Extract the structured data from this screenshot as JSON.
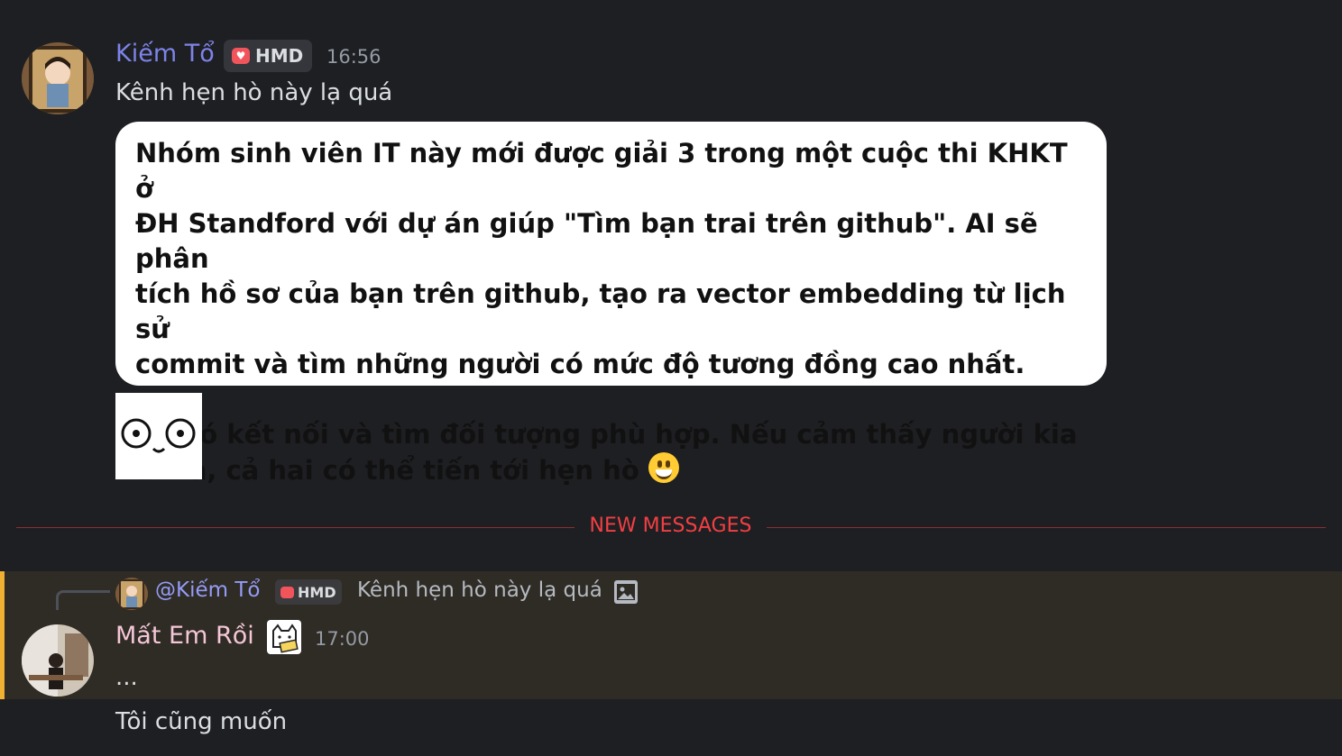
{
  "messages": [
    {
      "author": "Kiếm Tổ",
      "author_color": "#7d84e8",
      "badge": "HMD",
      "time": "16:56",
      "text": "Kênh hẹn hò này lạ quá",
      "card_paragraphs": [
        "Nhóm sinh viên IT này mới được giải 3 trong một cuộc thi KHKT ở\nĐH Standford với dự án giúp \"Tìm bạn trai trên github\". AI sẽ phân\ntích hồ sơ của bạn trên github, tạo ra vector embedding từ lịch sử\ncommit và tìm những người có mức độ tương đồng cao nhất.",
        "Từ đó kết nối và tìm đối tượng phù hợp. Nếu cảm thấy người kia\nukila, cả hai có thể tiến tới hẹn hò"
      ],
      "card_emoji": "grinning-face-emoji",
      "sticker": "staring-eyes-sticker"
    }
  ],
  "divider": {
    "label": "NEW MESSAGES",
    "color": "#f23f43"
  },
  "reply": {
    "reply_to": {
      "mention": "@Kiếm Tổ",
      "badge": "HMD",
      "snippet": "Kênh hẹn hò này lạ quá",
      "attachment_icon": "image-icon"
    },
    "author": "Mất Em Rồi",
    "author_color": "#f4c7d8",
    "author_badge_icon": "cat-sticker-badge-icon",
    "time": "17:00",
    "text": "...",
    "follow_up": "Tôi cũng muốn"
  },
  "colors": {
    "background": "#1e1f22",
    "highlight": "#2f2b25",
    "highlight_bar": "#f0b232",
    "mention": "#949cf7"
  }
}
